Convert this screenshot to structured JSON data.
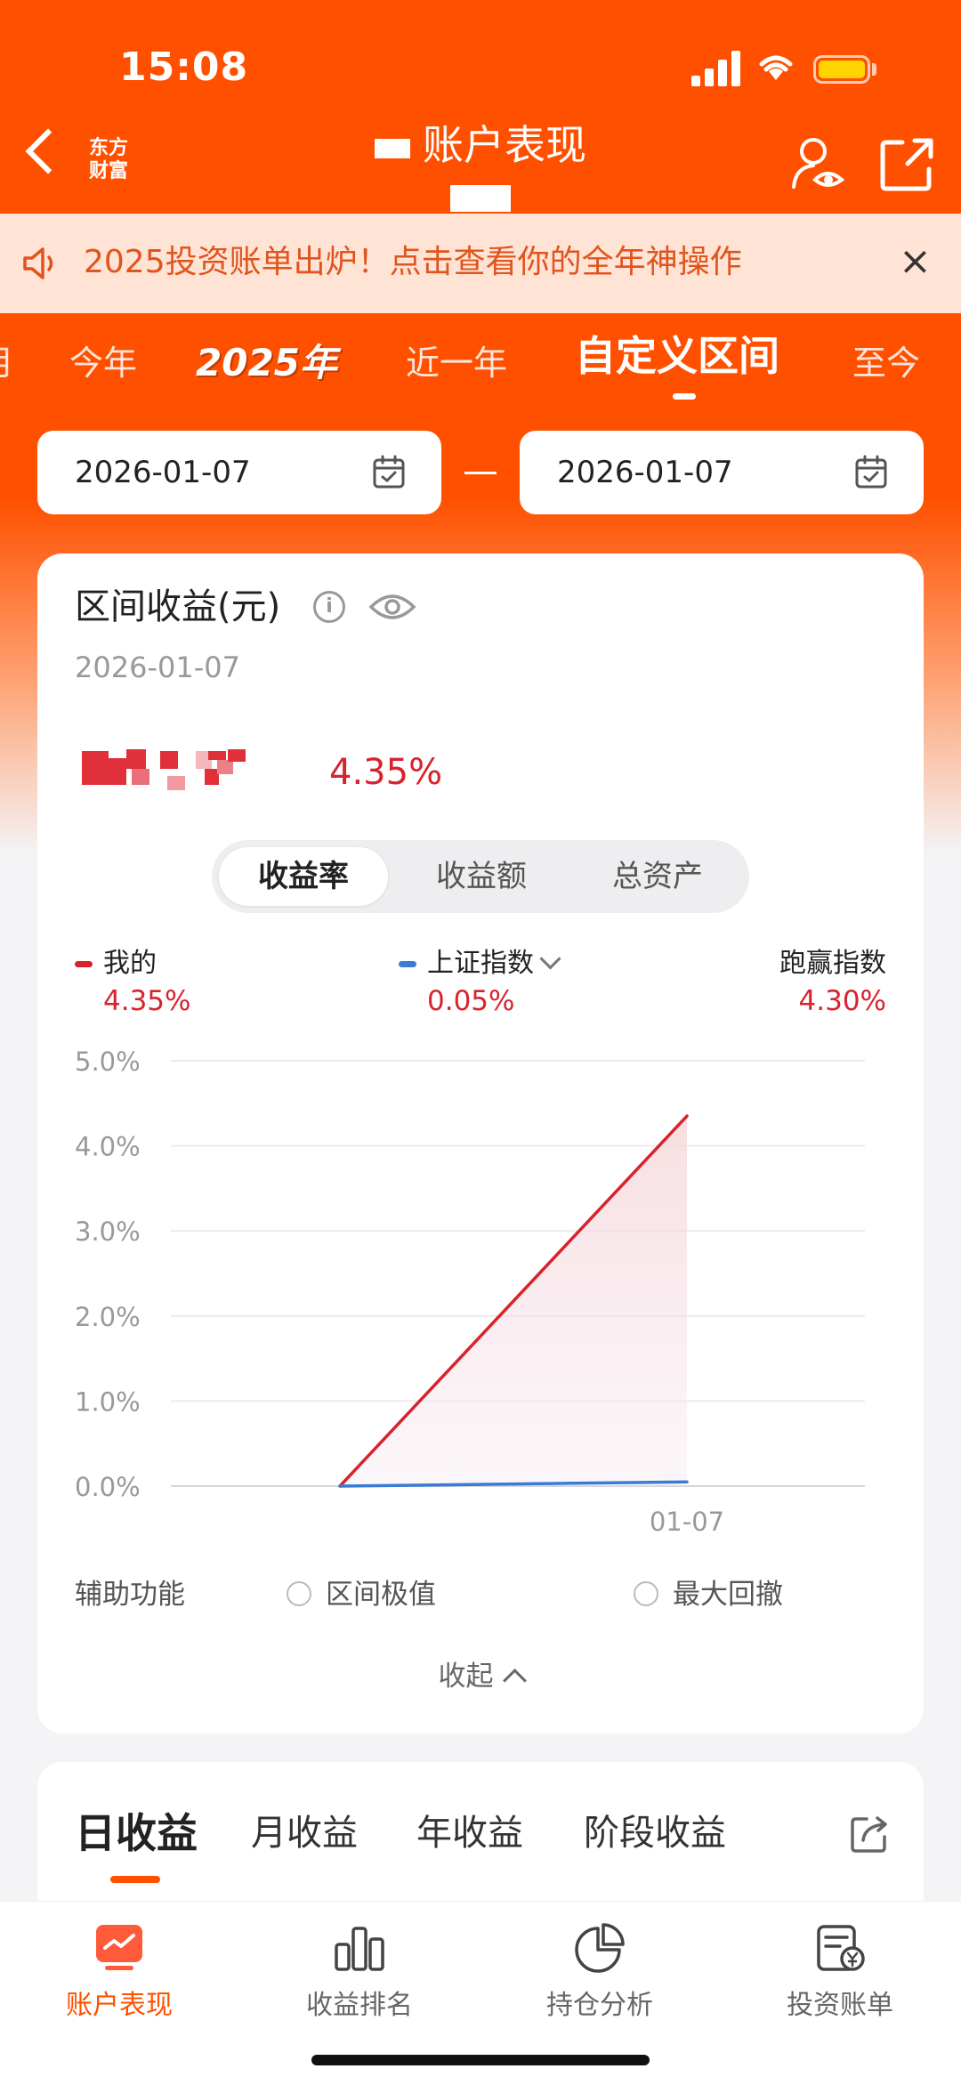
{
  "status_bar": {
    "time": "15:08"
  },
  "nav": {
    "logo": "东方\n财富",
    "title": "账户表现"
  },
  "banner": {
    "text": "2025投资账单出炉！点击查看你的全年神操作",
    "close": "×"
  },
  "period_tabs": [
    {
      "label": "月"
    },
    {
      "label": "今年"
    },
    {
      "label": "2025年"
    },
    {
      "label": "近一年"
    },
    {
      "label": "自定义区间"
    },
    {
      "label": "至今"
    }
  ],
  "date_range": {
    "start": "2026-01-07",
    "end": "2026-01-07"
  },
  "card": {
    "title": "区间收益(元)",
    "date": "2026-01-07",
    "return_pct": "4.35%",
    "segments": [
      "收益率",
      "收益额",
      "总资产"
    ],
    "legend": {
      "mine": {
        "label": "我的",
        "value": "4.35%",
        "color": "#d8232c"
      },
      "index": {
        "label": "上证指数",
        "value": "0.05%",
        "color": "#3a7bd5"
      },
      "beat": {
        "label": "跑赢指数",
        "value": "4.30%"
      }
    },
    "aux_label": "辅助功能",
    "aux_options": [
      "区间极值",
      "最大回撤"
    ],
    "collapse": "收起"
  },
  "chart_data": {
    "type": "line",
    "x": [
      "",
      "01-07"
    ],
    "x_tick_labels": [
      "01-07"
    ],
    "y_ticks": [
      "5.0%",
      "4.0%",
      "3.0%",
      "2.0%",
      "1.0%",
      "0.0%"
    ],
    "ylim": [
      0,
      5
    ],
    "grid": true,
    "series": [
      {
        "name": "我的",
        "values": [
          0,
          4.35
        ],
        "color": "#d8232c"
      },
      {
        "name": "上证指数",
        "values": [
          0,
          0.05
        ],
        "color": "#3a7bd5"
      }
    ]
  },
  "income_tabs": [
    "日收益",
    "月收益",
    "年收益",
    "阶段收益"
  ],
  "bottom_nav": [
    {
      "label": "账户表现",
      "icon": "chart-monitor-icon",
      "active": true
    },
    {
      "label": "收益排名",
      "icon": "bar-chart-icon"
    },
    {
      "label": "持仓分析",
      "icon": "pie-chart-icon"
    },
    {
      "label": "投资账单",
      "icon": "bill-icon"
    }
  ],
  "colors": {
    "brand": "#ff5000",
    "rise": "#d8232c",
    "index": "#3a7bd5"
  }
}
